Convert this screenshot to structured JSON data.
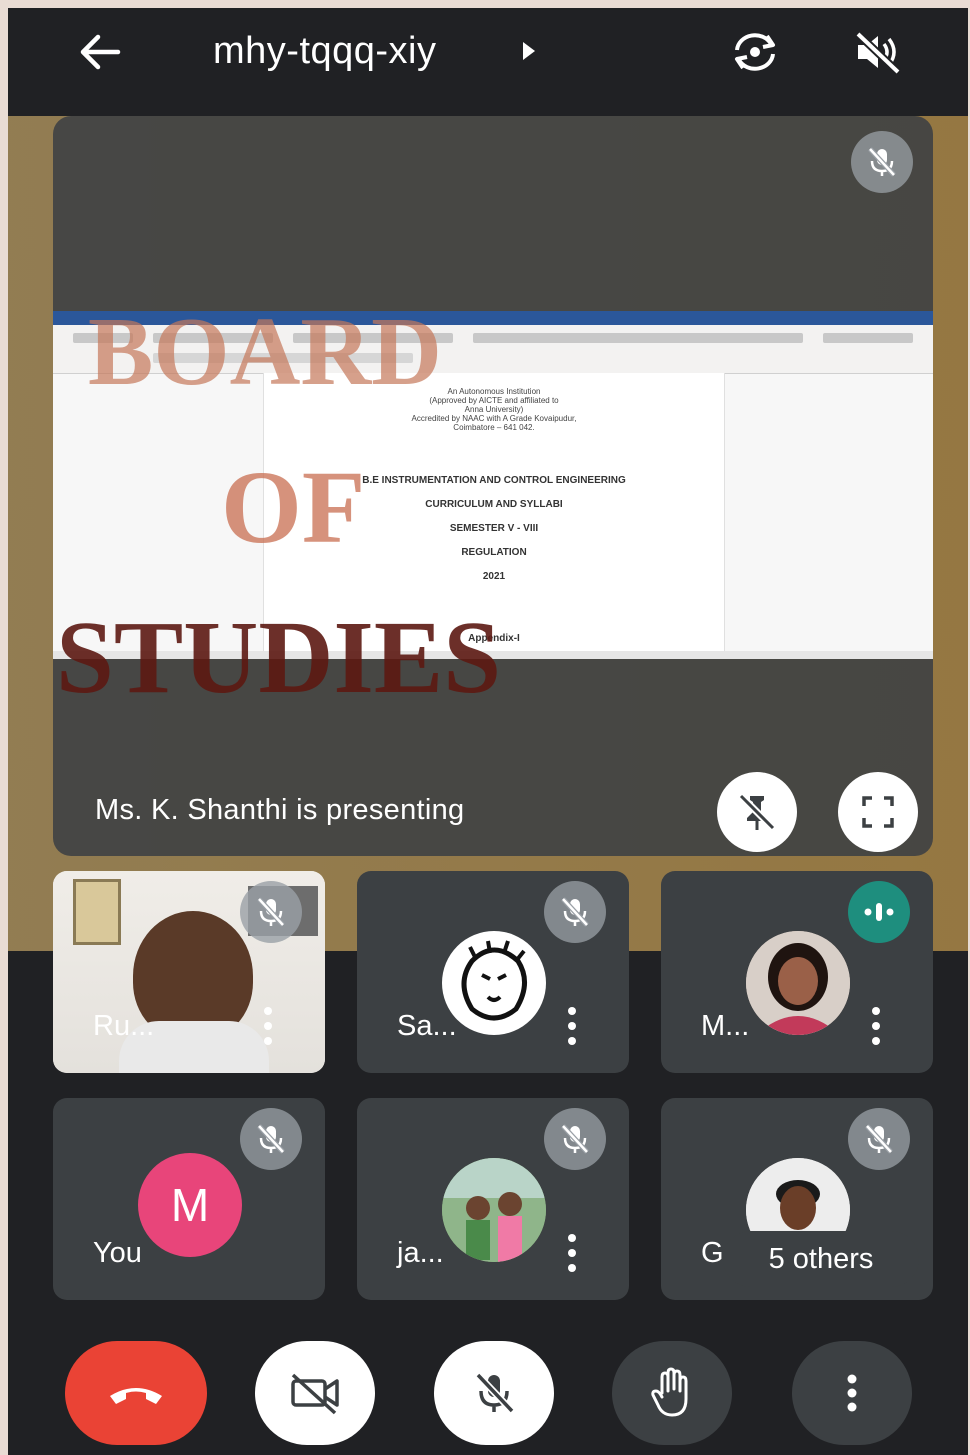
{
  "topbar": {
    "meeting_code": "mhy-tqqq-xiy"
  },
  "presentation": {
    "status_text": "Ms. K. Shanthi is presenting",
    "document": {
      "line1": "An Autonomous Institution",
      "line2": "(Approved by AICTE and affiliated to",
      "line3": "Anna University)",
      "line4": "Accredited by NAAC with A Grade Kovaipudur,",
      "line5": "Coimbatore – 641 042.",
      "title": "B.E INSTRUMENTATION AND CONTROL ENGINEERING",
      "subtitle": "CURRICULUM AND SYLLABI",
      "semester": "SEMESTER V - VIII",
      "regulation": "REGULATION",
      "year": "2021",
      "appendix": "Appendix-I"
    }
  },
  "watermark": {
    "word1": "BOARD",
    "word2": "OF",
    "word3": "STUDIES"
  },
  "participants": [
    {
      "name": "Ru...",
      "muted": true
    },
    {
      "name": "Sa...",
      "muted": true
    },
    {
      "name": "M...",
      "muted": false,
      "speaking": true
    },
    {
      "name": "You",
      "initial": "M",
      "muted": true
    },
    {
      "name": "ja...",
      "muted": true
    },
    {
      "name": "Ga",
      "others_label": "5 others",
      "muted": true
    }
  ],
  "colors": {
    "background": "#202124",
    "tile": "#3c4043",
    "end_call": "#ea4335",
    "avatar_you": "#e8457a",
    "speaking": "#1e8e7e"
  },
  "icons": {
    "back": "arrow-left-icon",
    "switch_camera": "switch-camera-icon",
    "speaker_off": "speaker-off-icon",
    "end_call": "phone-hangup-icon",
    "camera_off": "camera-off-icon",
    "mic_off": "mic-off-icon",
    "raise_hand": "hand-icon",
    "more": "more-vert-icon",
    "unpin": "unpin-icon",
    "fullscreen": "fullscreen-icon"
  }
}
